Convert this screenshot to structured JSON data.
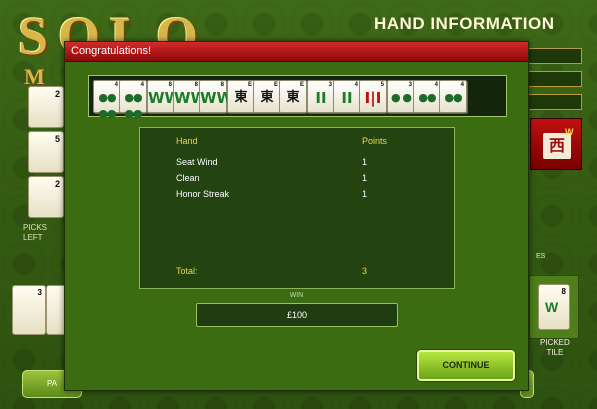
{
  "modal": {
    "title": "Congratulations!",
    "tiles": [
      {
        "index": "4",
        "face": "●●\n●●",
        "kind": "circle"
      },
      {
        "index": "4",
        "face": "●●\n●●",
        "kind": "circle"
      },
      {
        "index": "8",
        "face": "WW",
        "kind": "bam"
      },
      {
        "index": "8",
        "face": "WW",
        "kind": "bam"
      },
      {
        "index": "8",
        "face": "WW",
        "kind": "bam"
      },
      {
        "index": "E",
        "face": "東",
        "kind": "char"
      },
      {
        "index": "E",
        "face": "東",
        "kind": "char"
      },
      {
        "index": "E",
        "face": "東",
        "kind": "char"
      },
      {
        "index": "3",
        "face": "II",
        "kind": "bam"
      },
      {
        "index": "4",
        "face": "II",
        "kind": "bam"
      },
      {
        "index": "5",
        "face": "I|I",
        "kind": "bam-red"
      },
      {
        "index": "3",
        "face": "● ●",
        "kind": "circle"
      },
      {
        "index": "4",
        "face": "●●",
        "kind": "circle"
      },
      {
        "index": "4",
        "face": "●●",
        "kind": "circle"
      }
    ],
    "score_table": {
      "hand_header": "Hand",
      "points_header": "Points",
      "rows": [
        {
          "hand": "Seat Wind",
          "points": "1"
        },
        {
          "hand": "Clean",
          "points": "1"
        },
        {
          "hand": "Honor Streak",
          "points": "1"
        }
      ],
      "total_label": "Total:",
      "total_value": "3"
    },
    "win_label": "WIN",
    "win_amount": "£100",
    "continue_label": "CONTINUE"
  },
  "background": {
    "hand_information_title": "HAND INFORMATION",
    "picks_left_label": "PICKS\nLEFT",
    "picked_tile_label": "PICKED\nTILE",
    "picked_tile_index": "8",
    "red_tile_glyph": "西",
    "red_tile_tag": "W",
    "side_tile_numbers": [
      "2",
      "5",
      "2"
    ],
    "bottom_button_left_label": "PA",
    "left_tile_index": "3"
  },
  "colors": {
    "header_red": "#b81818",
    "panel_green": "#234311",
    "accent_gold": "#f1d34f",
    "button_green": "#9ccd2e"
  }
}
